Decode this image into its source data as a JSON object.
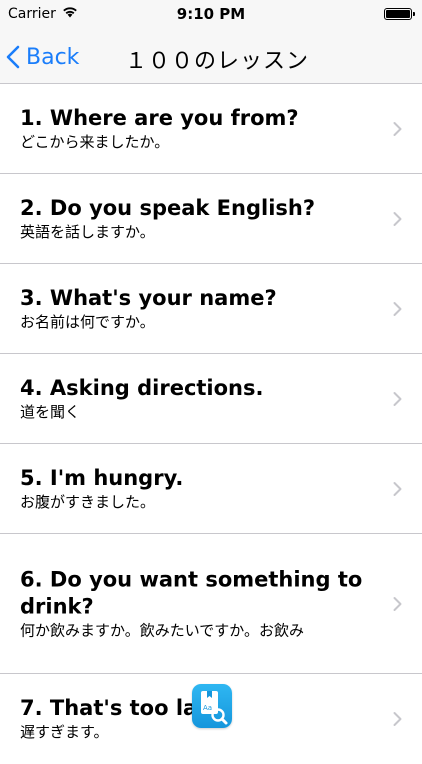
{
  "status_bar": {
    "carrier": "Carrier",
    "time": "9:10 PM",
    "wifi_icon": "wifi-icon",
    "battery_icon": "battery-icon"
  },
  "nav": {
    "back_label": "Back",
    "back_icon": "chevron-left-icon",
    "title": "１００のレッスン"
  },
  "lessons": [
    {
      "title": "1. Where are you from?",
      "subtitle": "どこから来ましたか。"
    },
    {
      "title": "2. Do you speak English?",
      "subtitle": "英語を話しますか。"
    },
    {
      "title": "3. What's your name?",
      "subtitle": "お名前は何ですか。"
    },
    {
      "title": "4. Asking directions.",
      "subtitle": "道を聞く"
    },
    {
      "title": "5. I'm hungry.",
      "subtitle": "お腹がすきました。"
    },
    {
      "title": "6. Do you want something to drink?",
      "subtitle": "何か飲みますか。飲みたいですか。お飲み"
    },
    {
      "title": "7. That's too lat",
      "subtitle": "遅すぎます。"
    }
  ],
  "dictionary_icon": {
    "name": "dictionary-search-icon",
    "label": "Aa",
    "color": "#1fa7ea"
  },
  "colors": {
    "accent": "#1a7dfa",
    "bar_background": "#f7f7f7",
    "separator": "#c8c7cc",
    "chevron": "#c7c7cc"
  }
}
